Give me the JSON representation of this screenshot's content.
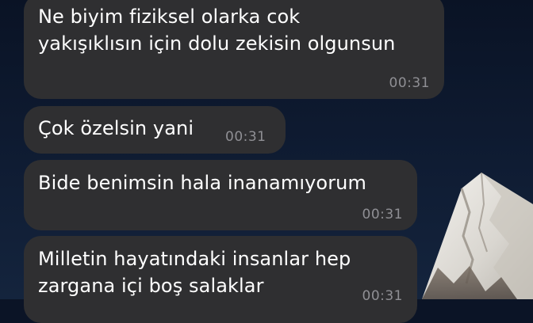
{
  "messages": [
    {
      "text": "Ne biyim fiziksel olarka cok\nyakışıklısın için dolu zekisin olgunsun",
      "time": "00:31"
    },
    {
      "text": "Çok özelsin yani",
      "time": "00:31"
    },
    {
      "text": "Bide benimsin hala inanamıyorum",
      "time": "00:31"
    },
    {
      "text": "Milletin hayatındaki insanlar hep\nzargana içi boş salaklar",
      "time": "00:31"
    }
  ],
  "colors": {
    "bubble": "#2f2f31",
    "text": "#ffffff",
    "timestamp": "#8f8f94",
    "background": "#0b1426"
  },
  "wallpaper": {
    "icon": "mountain-wallpaper"
  }
}
